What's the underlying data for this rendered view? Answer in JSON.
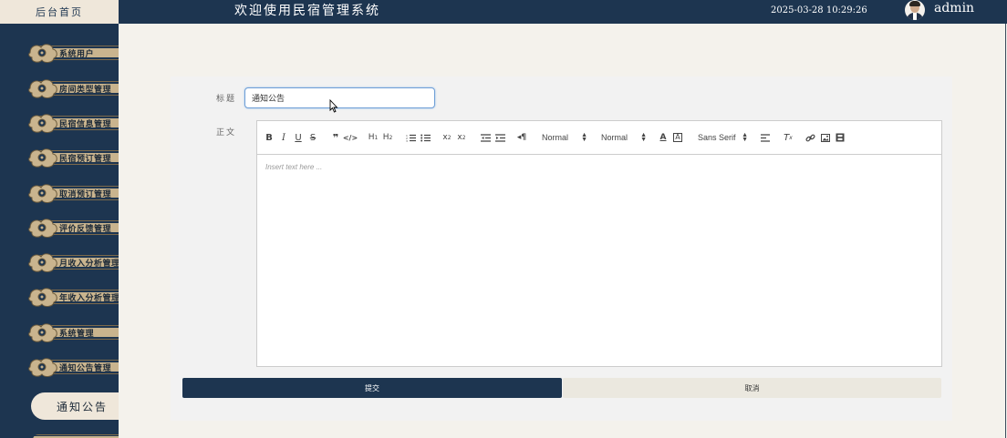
{
  "header": {
    "home_tab": "后台首页",
    "title": "欢迎使用民宿管理系统",
    "datetime": "2025-03-28 10:29:26",
    "username": "admin",
    "avatar_icon": "user-avatar"
  },
  "sidebar": {
    "items": [
      {
        "label": "系统用户"
      },
      {
        "label": "房间类型管理"
      },
      {
        "label": "民宿信息管理"
      },
      {
        "label": "民宿预订管理"
      },
      {
        "label": "取消预订管理"
      },
      {
        "label": "评价反馈管理"
      },
      {
        "label": "月收入分析管理"
      },
      {
        "label": "年收入分析管理"
      },
      {
        "label": "系统管理"
      },
      {
        "label": "通知公告管理"
      }
    ],
    "active_item": "通知公告"
  },
  "form": {
    "title_label": "标题",
    "title_value": "通知公告",
    "body_label": "正文",
    "editor": {
      "header_picker": "Normal",
      "size_picker": "Normal",
      "font_picker": "Sans Serif",
      "placeholder": "Insert text here ...",
      "toolbar_icons": [
        "bold-icon",
        "italic-icon",
        "underline-icon",
        "strike-icon",
        "blockquote-icon",
        "code-icon",
        "h1-icon",
        "h2-icon",
        "ordered-list-icon",
        "bullet-list-icon",
        "subscript-icon",
        "superscript-icon",
        "outdent-icon",
        "indent-icon",
        "rtl-icon",
        "text-color-icon",
        "background-color-icon",
        "align-icon",
        "clean-icon",
        "link-icon",
        "image-icon",
        "video-icon"
      ]
    },
    "submit_label": "提交",
    "cancel_label": "取消"
  },
  "colors": {
    "navy": "#1d3550",
    "cream": "#efe7da",
    "gold": "#c9b48e",
    "input_focus": "#6d9ed6"
  }
}
